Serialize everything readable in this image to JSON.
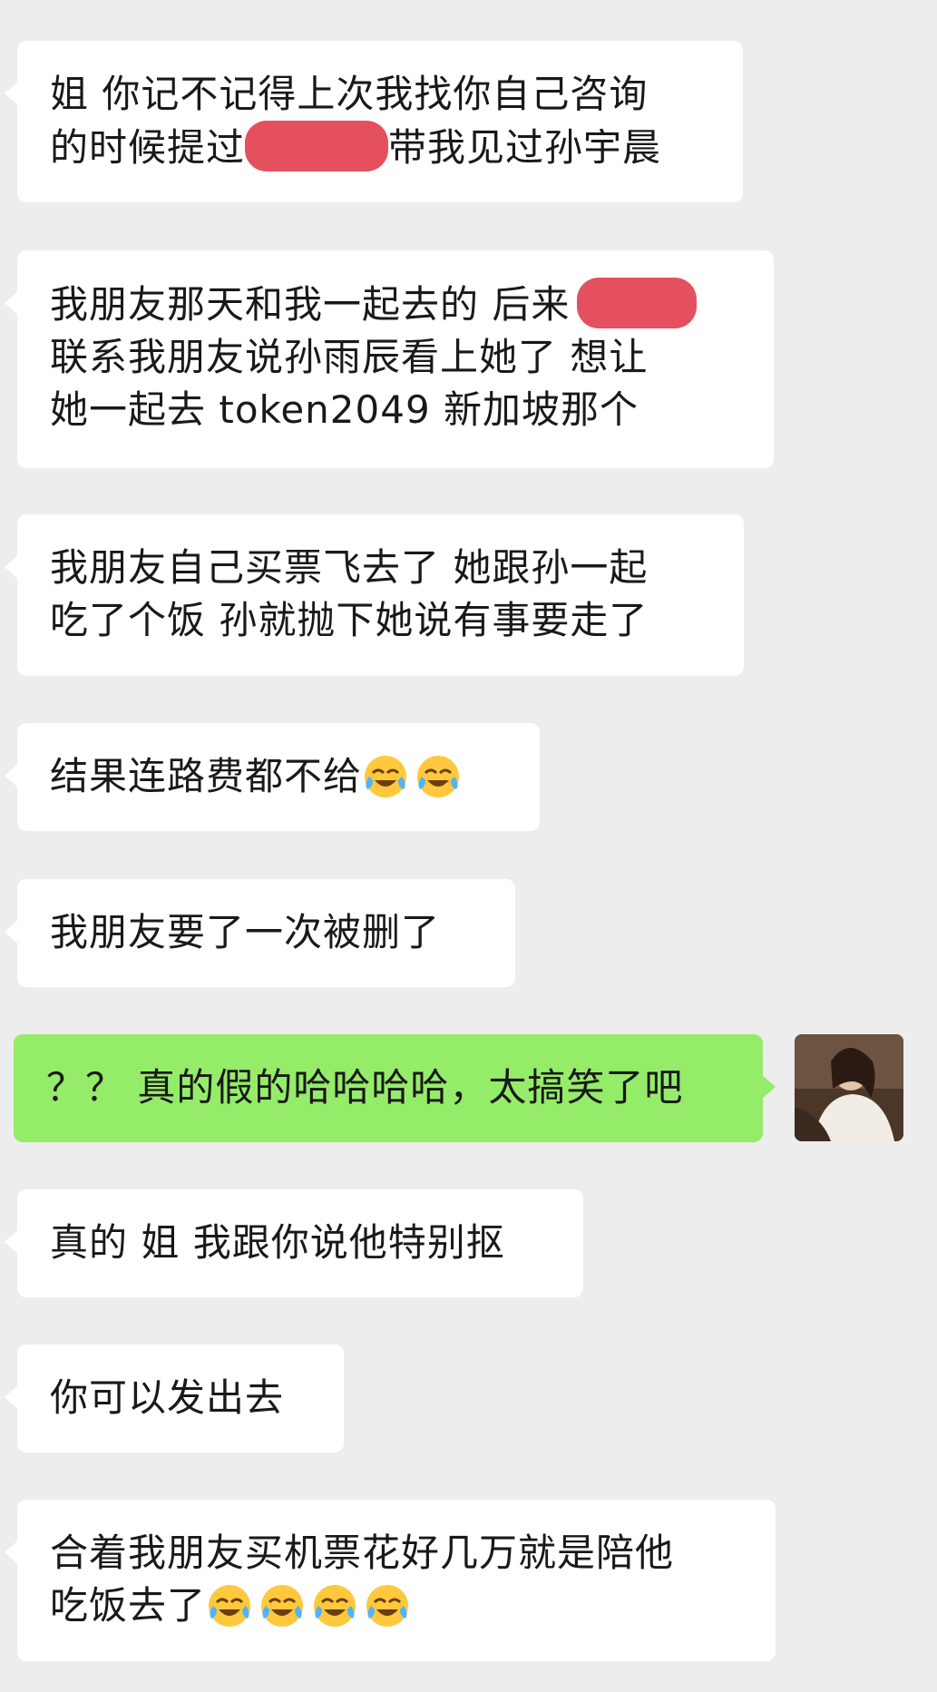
{
  "chat": {
    "messages": [
      {
        "sender": "other",
        "lines": [
          "姐 你记不记得上次我找你自己咨询",
          "的时候提过",
          "带我见过孙宇晨"
        ]
      },
      {
        "sender": "other",
        "lines": [
          "我朋友那天和我一起去的 后来",
          "联系我朋友说孙雨辰看上她了 想让",
          "她一起去 token2049 新加坡那个"
        ]
      },
      {
        "sender": "other",
        "lines": [
          "我朋友自己买票飞去了 她跟孙一起",
          "吃了个饭 孙就抛下她说有事要走了"
        ]
      },
      {
        "sender": "other",
        "lines": [
          "结果连路费都不给"
        ],
        "emojis": [
          "crying-laughing",
          "crying-laughing"
        ]
      },
      {
        "sender": "other",
        "lines": [
          "我朋友要了一次被删了"
        ]
      },
      {
        "sender": "me",
        "lines": [
          "？？ 真的假的哈哈哈哈，太搞笑了吧"
        ]
      },
      {
        "sender": "other",
        "lines": [
          "真的 姐 我跟你说他特别抠"
        ]
      },
      {
        "sender": "other",
        "lines": [
          "你可以发出去"
        ]
      },
      {
        "sender": "other",
        "lines": [
          "合着我朋友买机票花好几万就是陪他",
          "吃饭去了"
        ],
        "emojis": [
          "crying-laughing",
          "crying-laughing",
          "crying-laughing",
          "crying-laughing"
        ]
      }
    ]
  },
  "colors": {
    "background": "#ededed",
    "incoming_bubble": "#ffffff",
    "outgoing_bubble": "#95ec69",
    "redaction": "#e5505f"
  }
}
